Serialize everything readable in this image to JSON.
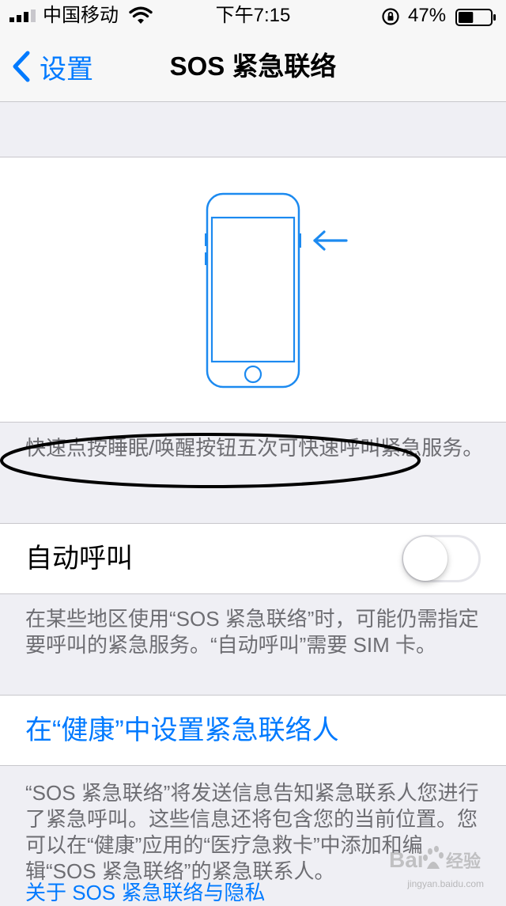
{
  "status_bar": {
    "carrier": "中国移动",
    "time": "下午7:15",
    "battery_percent": "47%",
    "battery_level": 0.47,
    "icons": [
      "signal-icon",
      "wifi-icon",
      "orientation-lock-icon",
      "battery-icon"
    ]
  },
  "nav": {
    "back_label": "设置",
    "title": "SOS 紧急联络"
  },
  "illustration": {
    "icon": "phone-side-button-icon",
    "arrow_icon": "arrow-left-icon"
  },
  "notes": {
    "side_button": "快速点按睡眠/唤醒按钮五次可快速呼叫紧急服务。",
    "auto_call": "在某些地区使用“SOS 紧急联络”时，可能仍需指定要呼叫的紧急服务。“自动呼叫”需要 SIM 卡。",
    "contacts": "“SOS 紧急联络”将发送信息告知紧急联系人您进行了紧急呼叫。这些信息还将包含您的当前位置。您可以在“健康”应用的“医疗急救卡”中添加和编辑“SOS 紧急联络”的紧急联系人。"
  },
  "auto_call": {
    "label": "自动呼叫",
    "enabled": false
  },
  "health_link": {
    "label": "在“健康”中设置紧急联络人"
  },
  "privacy_link": {
    "label": "关于 SOS 紧急联络与隐私"
  },
  "watermark": {
    "text": "Bai",
    "text2": "经验",
    "sub": "jingyan.baidu.com"
  },
  "colors": {
    "accent": "#007aff",
    "background": "#efeff4",
    "secondary_text": "#6d6d72",
    "separator": "#c8c7cc"
  }
}
